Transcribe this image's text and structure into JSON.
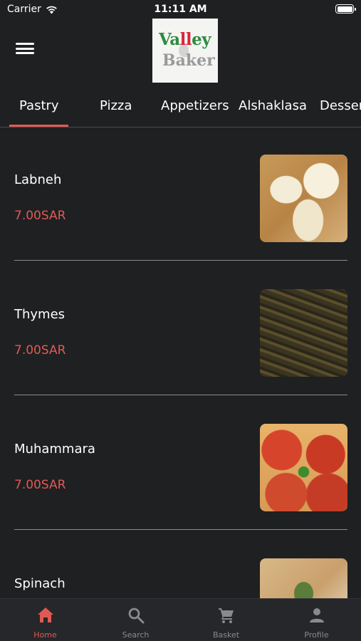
{
  "status_bar": {
    "carrier": "Carrier",
    "time": "11:11 AM"
  },
  "header": {
    "logo_line1_a": "Va",
    "logo_line1_b": "ll",
    "logo_line1_c": "ey",
    "logo_line2": "Baker",
    "menu_icon": "hamburger-menu-icon"
  },
  "tabs": [
    {
      "label": "Pastry",
      "active": true
    },
    {
      "label": "Pizza",
      "active": false
    },
    {
      "label": "Appetizers",
      "active": false
    },
    {
      "label": "Alshaklasa",
      "active": false
    },
    {
      "label": "Desserts",
      "active": false
    }
  ],
  "items": [
    {
      "name": "Labneh",
      "price": "7.00SAR"
    },
    {
      "name": "Thymes",
      "price": "7.00SAR"
    },
    {
      "name": "Muhammara",
      "price": "7.00SAR"
    },
    {
      "name": "Spinach",
      "price": ""
    }
  ],
  "bottom_nav": [
    {
      "label": "Home",
      "icon": "home-icon",
      "active": true
    },
    {
      "label": "Search",
      "icon": "search-icon",
      "active": false
    },
    {
      "label": "Basket",
      "icon": "cart-icon",
      "active": false
    },
    {
      "label": "Profile",
      "icon": "profile-icon",
      "active": false
    }
  ],
  "colors": {
    "background": "#1f2022",
    "accent": "#e05a55",
    "nav_background": "#26272a",
    "inactive": "#8a8a8c"
  }
}
